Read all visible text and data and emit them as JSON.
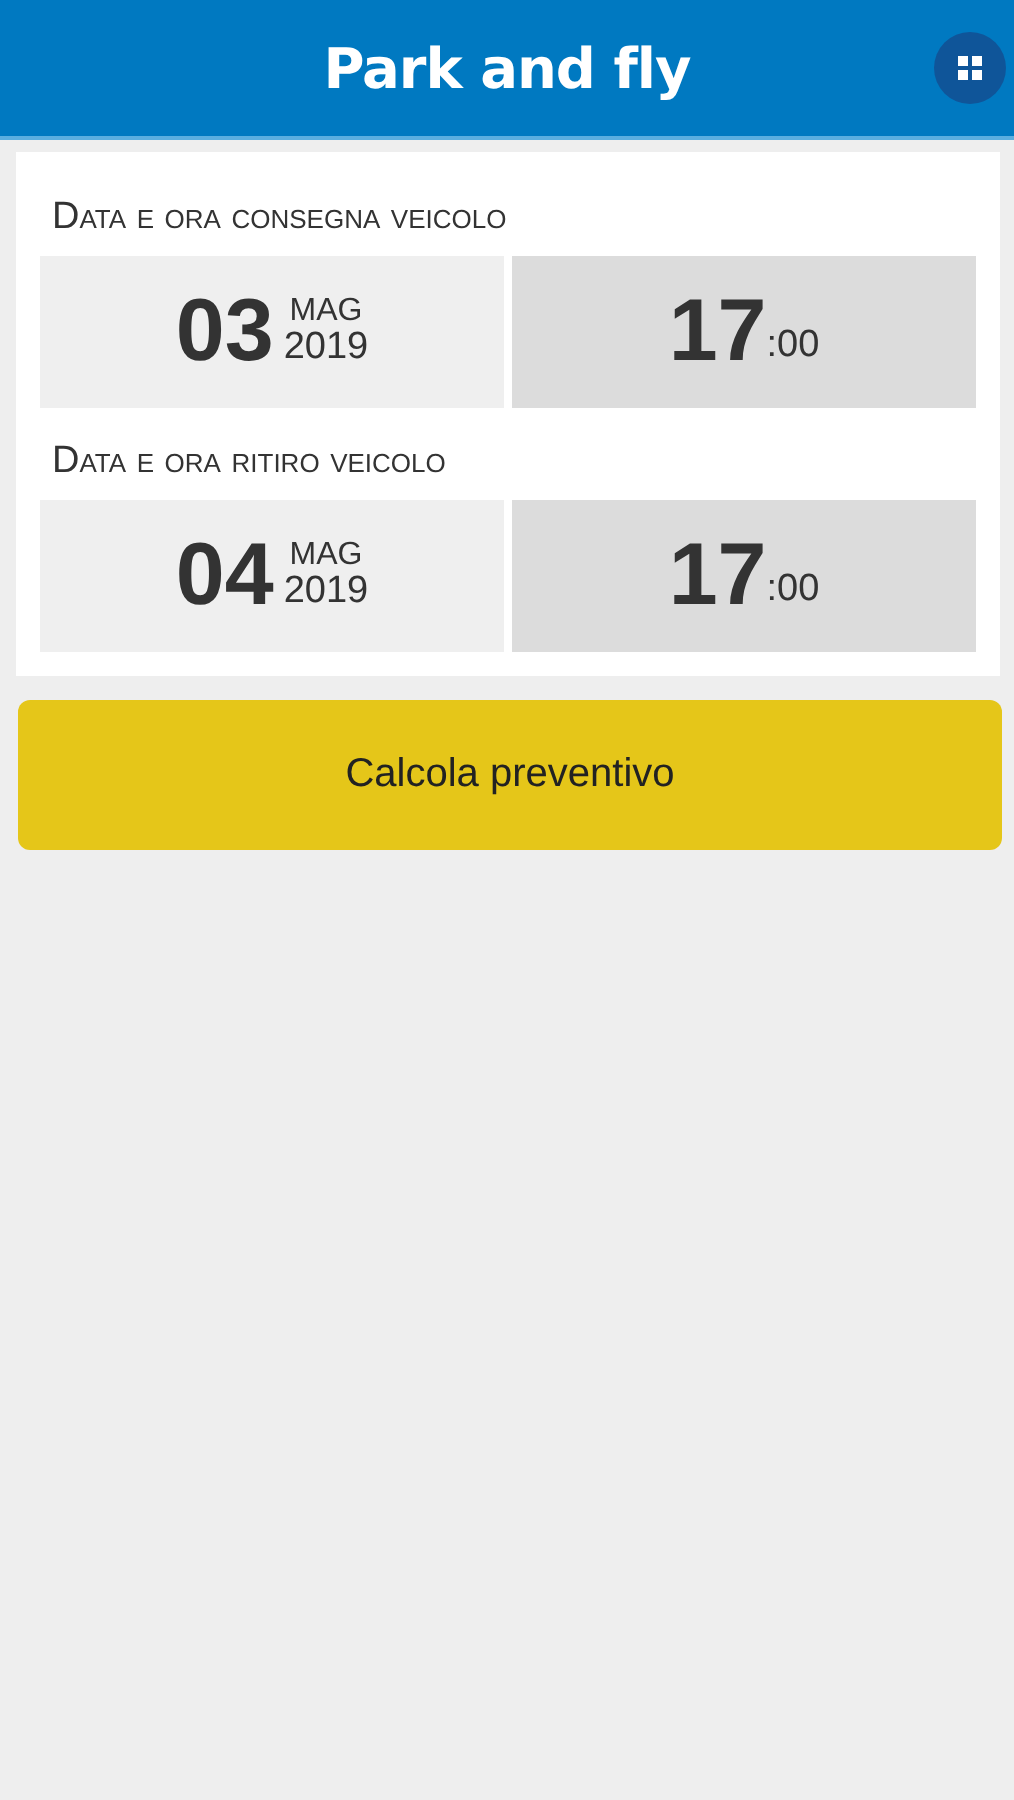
{
  "header": {
    "title": "Park and fly"
  },
  "sections": [
    {
      "label": "Data e ora consegna veicolo",
      "date": {
        "day": "03",
        "month": "MAG",
        "year": "2019"
      },
      "time": {
        "hour": "17",
        "minutes": ":00"
      }
    },
    {
      "label": "Data e ora ritiro veicolo",
      "date": {
        "day": "04",
        "month": "MAG",
        "year": "2019"
      },
      "time": {
        "hour": "17",
        "minutes": ":00"
      }
    }
  ],
  "action": {
    "label": "Calcola preventivo"
  }
}
